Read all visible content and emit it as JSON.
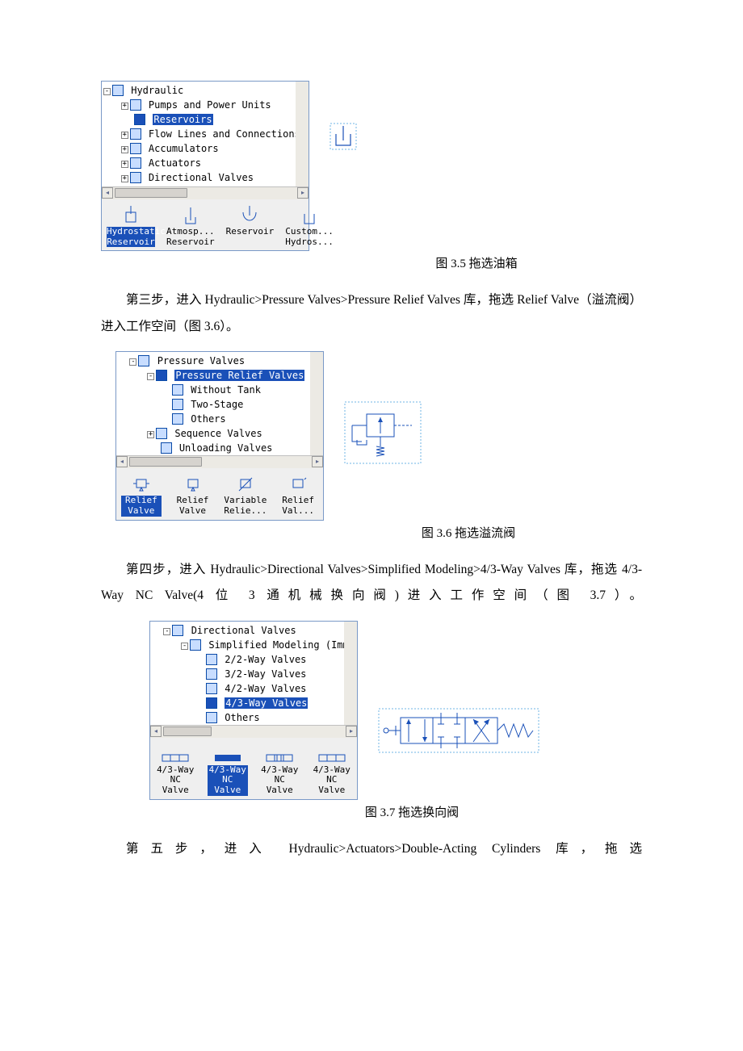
{
  "fig35": {
    "caption": "图 3.5 拖选油箱",
    "tree": {
      "root": "Hydraulic",
      "items": [
        "Pumps and Power Units",
        "Reservoirs",
        "Flow Lines and Connections",
        "Accumulators",
        "Actuators",
        "Directional Valves"
      ],
      "expanders": [
        "-",
        "+",
        "",
        "+",
        "+",
        "+",
        "+"
      ]
    },
    "palette": [
      {
        "label": "Hydrostatic Reservoir",
        "selected": true
      },
      {
        "label": "Atmosp... Reservoir",
        "selected": false
      },
      {
        "label": "Reservoir",
        "selected": false
      },
      {
        "label": "Custom... Hydros...",
        "selected": false
      }
    ]
  },
  "para3": "第三步，进入 Hydraulic>Pressure Valves>Pressure Relief Valves 库，拖选 Relief Valve（溢流阀）进入工作空间（图 3.6）。",
  "fig36": {
    "caption": "图 3.6 拖选溢流阀",
    "tree": {
      "root": "Pressure Valves",
      "sub": "Pressure Relief Valves",
      "items": [
        "Without Tank",
        "Two-Stage",
        "Others"
      ],
      "tail": [
        "Sequence Valves",
        "Unloading Valves"
      ],
      "expanders": [
        "-",
        "-",
        "",
        "",
        "",
        "+",
        ""
      ]
    },
    "palette": [
      {
        "label": "Relief Valve",
        "selected": true
      },
      {
        "label": "Relief Valve",
        "selected": false
      },
      {
        "label": "Variable Relie...",
        "selected": false
      },
      {
        "label": "Relief Val...",
        "selected": false
      }
    ]
  },
  "para4": "第四步，进入 Hydraulic>Directional Valves>Simplified Modeling>4/3-Way Valves 库，拖选 4/3-Way NC Valve(4 位 3 通机械换向阀)进入工作空间（图 3.7）。",
  "fig37": {
    "caption": "图 3.7 拖选换向阀",
    "tree": {
      "root": "Directional Valves",
      "sub": "Simplified Modeling (Imm",
      "items": [
        "2/2-Way Valves",
        "3/2-Way Valves",
        "4/2-Way Valves",
        "4/3-Way Valves",
        "Others"
      ],
      "expanders": [
        "-",
        "-",
        "",
        "",
        "",
        "",
        ""
      ]
    },
    "palette": [
      {
        "label": "4/3-Way NC Valve",
        "selected": false
      },
      {
        "label": "4/3-Way NC Valve",
        "selected": true
      },
      {
        "label": "4/3-Way NC Valve",
        "selected": false
      },
      {
        "label": "4/3-Way NC Valve",
        "selected": false
      }
    ]
  },
  "para5": "第五步，进入 Hydraulic>Actuators>Double-Acting Cylinders 库，拖选"
}
